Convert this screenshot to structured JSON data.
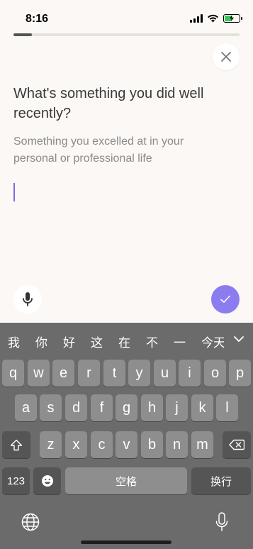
{
  "status_bar": {
    "time": "8:16",
    "battery_color": "#34C759",
    "battery_level": 0.55
  },
  "progress": {
    "fraction": 0.08
  },
  "prompt": {
    "question": "What's something you did well recently?",
    "subtitle": "Something you excelled at in your personal or professional life"
  },
  "colors": {
    "accent": "#8B7CF0",
    "cursor": "#7C6BE8",
    "background": "#FCF8F5"
  },
  "keyboard": {
    "candidates": [
      "我",
      "你",
      "好",
      "这",
      "在",
      "不",
      "一",
      "今天"
    ],
    "row1": [
      "q",
      "w",
      "e",
      "r",
      "t",
      "y",
      "u",
      "i",
      "o",
      "p"
    ],
    "row2": [
      "a",
      "s",
      "d",
      "f",
      "g",
      "h",
      "j",
      "k",
      "l"
    ],
    "row3": [
      "z",
      "x",
      "c",
      "v",
      "b",
      "n",
      "m"
    ],
    "numbers_label": "123",
    "space_label": "空格",
    "return_label": "换行"
  },
  "icons": {
    "close": "close-icon",
    "mic": "microphone-icon",
    "check": "checkmark-icon",
    "shift": "shift-icon",
    "delete": "delete-icon",
    "emoji": "emoji-icon",
    "globe": "globe-icon",
    "dictation": "dictation-icon"
  }
}
